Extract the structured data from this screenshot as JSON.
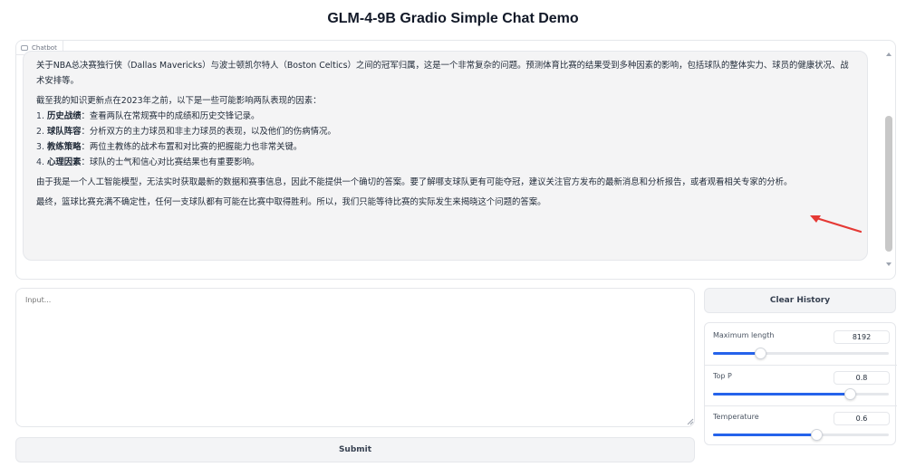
{
  "app": {
    "title": "GLM-4-9B Gradio Simple Chat Demo"
  },
  "chatbot": {
    "label": "Chatbot",
    "message": {
      "intro": "关于NBA总决赛独行侠（Dallas Mavericks）与波士顿凯尔特人（Boston Celtics）之间的冠军归属，这是一个非常复杂的问题。预测体育比赛的结果受到多种因素的影响，包括球队的整体实力、球员的健康状况、战术安排等。",
      "factors_intro": "截至我的知识更新点在2023年之前，以下是一些可能影响两队表现的因素：",
      "factors": [
        {
          "num": "1.",
          "title": "历史战绩",
          "text": "：查看两队在常规赛中的成绩和历史交锋记录。"
        },
        {
          "num": "2.",
          "title": "球队阵容",
          "text": "：分析双方的主力球员和非主力球员的表现，以及他们的伤病情况。"
        },
        {
          "num": "3.",
          "title": "教练策略",
          "text": "：两位主教练的战术布置和对比赛的把握能力也非常关键。"
        },
        {
          "num": "4.",
          "title": "心理因素",
          "text": "：球队的士气和信心对比赛结果也有重要影响。"
        }
      ],
      "disclaimer": "由于我是一个人工智能模型，无法实时获取最新的数据和赛事信息，因此不能提供一个确切的答案。要了解哪支球队更有可能夺冠，建议关注官方发布的最新消息和分析报告，或者观看相关专家的分析。",
      "conclusion": "最终，篮球比赛充满不确定性，任何一支球队都有可能在比赛中取得胜利。所以，我们只能等待比赛的实际发生来揭晓这个问题的答案。"
    }
  },
  "input": {
    "placeholder": "Input..."
  },
  "buttons": {
    "submit": "Submit",
    "clear": "Clear History"
  },
  "settings": {
    "max_length": {
      "label": "Maximum length",
      "value": "8192",
      "fraction": 0.27
    },
    "top_p": {
      "label": "Top P",
      "value": "0.8",
      "fraction": 0.78
    },
    "temperature": {
      "label": "Temperature",
      "value": "0.6",
      "fraction": 0.59
    }
  },
  "colors": {
    "accent": "#2563eb",
    "annotation_arrow": "#e53935"
  }
}
